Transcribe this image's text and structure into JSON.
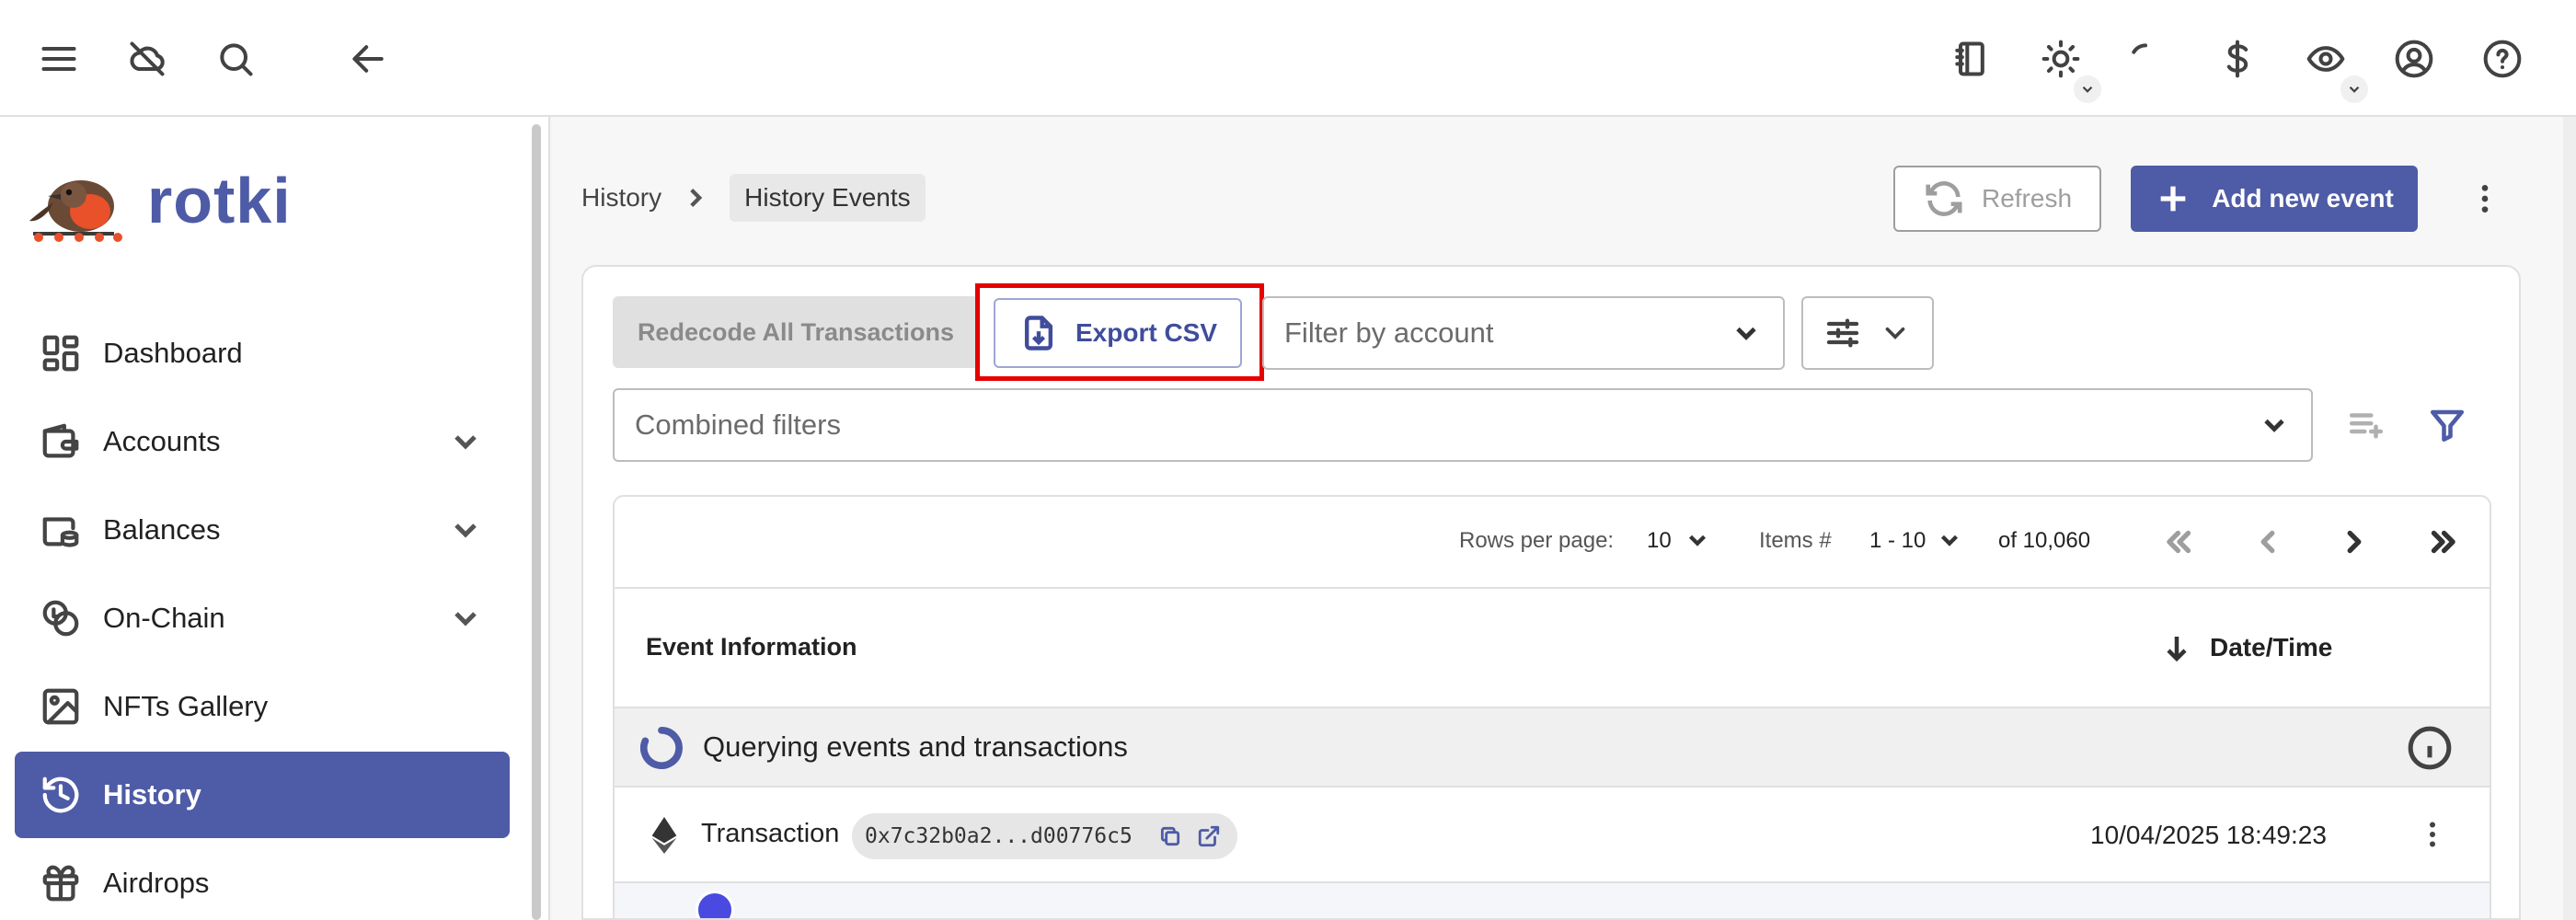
{
  "topbar": {
    "left_icons": [
      "menu-icon",
      "cloud-off-icon",
      "search-icon",
      "arrow-back-icon"
    ],
    "right_icons": [
      "notes-icon",
      "theme-sun-icon",
      "loading-icon",
      "currency-dollar-icon",
      "privacy-eye-icon",
      "account-circle-icon",
      "help-icon"
    ]
  },
  "sidebar": {
    "app_name": "rotki",
    "items": [
      {
        "label": "Dashboard",
        "icon": "dashboard-icon",
        "expandable": false
      },
      {
        "label": "Accounts",
        "icon": "wallet-icon",
        "expandable": true
      },
      {
        "label": "Balances",
        "icon": "balances-icon",
        "expandable": true
      },
      {
        "label": "On-Chain",
        "icon": "coins-icon",
        "expandable": true
      },
      {
        "label": "NFTs Gallery",
        "icon": "image-icon",
        "expandable": false
      },
      {
        "label": "History",
        "icon": "history-icon",
        "expandable": false,
        "active": true
      },
      {
        "label": "Airdrops",
        "icon": "gift-icon",
        "expandable": false
      }
    ]
  },
  "breadcrumb": {
    "parent": "History",
    "current": "History Events"
  },
  "header_actions": {
    "refresh_label": "Refresh",
    "add_label": "Add new event"
  },
  "toolbar": {
    "redecode_label": "Redecode All Transactions",
    "export_label": "Export CSV",
    "account_filter_placeholder": "Filter by account",
    "combined_filters_placeholder": "Combined filters"
  },
  "pagination": {
    "rows_per_page_label": "Rows per page:",
    "rows_per_page_value": "10",
    "items_label": "Items #",
    "items_range": "1 - 10",
    "total_text": "of 10,060"
  },
  "table": {
    "columns": [
      "Event Information",
      "Date/Time"
    ],
    "loading_text": "Querying events and transactions",
    "rows": [
      {
        "type": "Transaction",
        "hash": "0x7c32b0a2...d00776c5",
        "datetime": "10/04/2025 18:49:23"
      }
    ]
  },
  "colors": {
    "brand": "#4e5ba6",
    "highlight": "#e60000"
  }
}
